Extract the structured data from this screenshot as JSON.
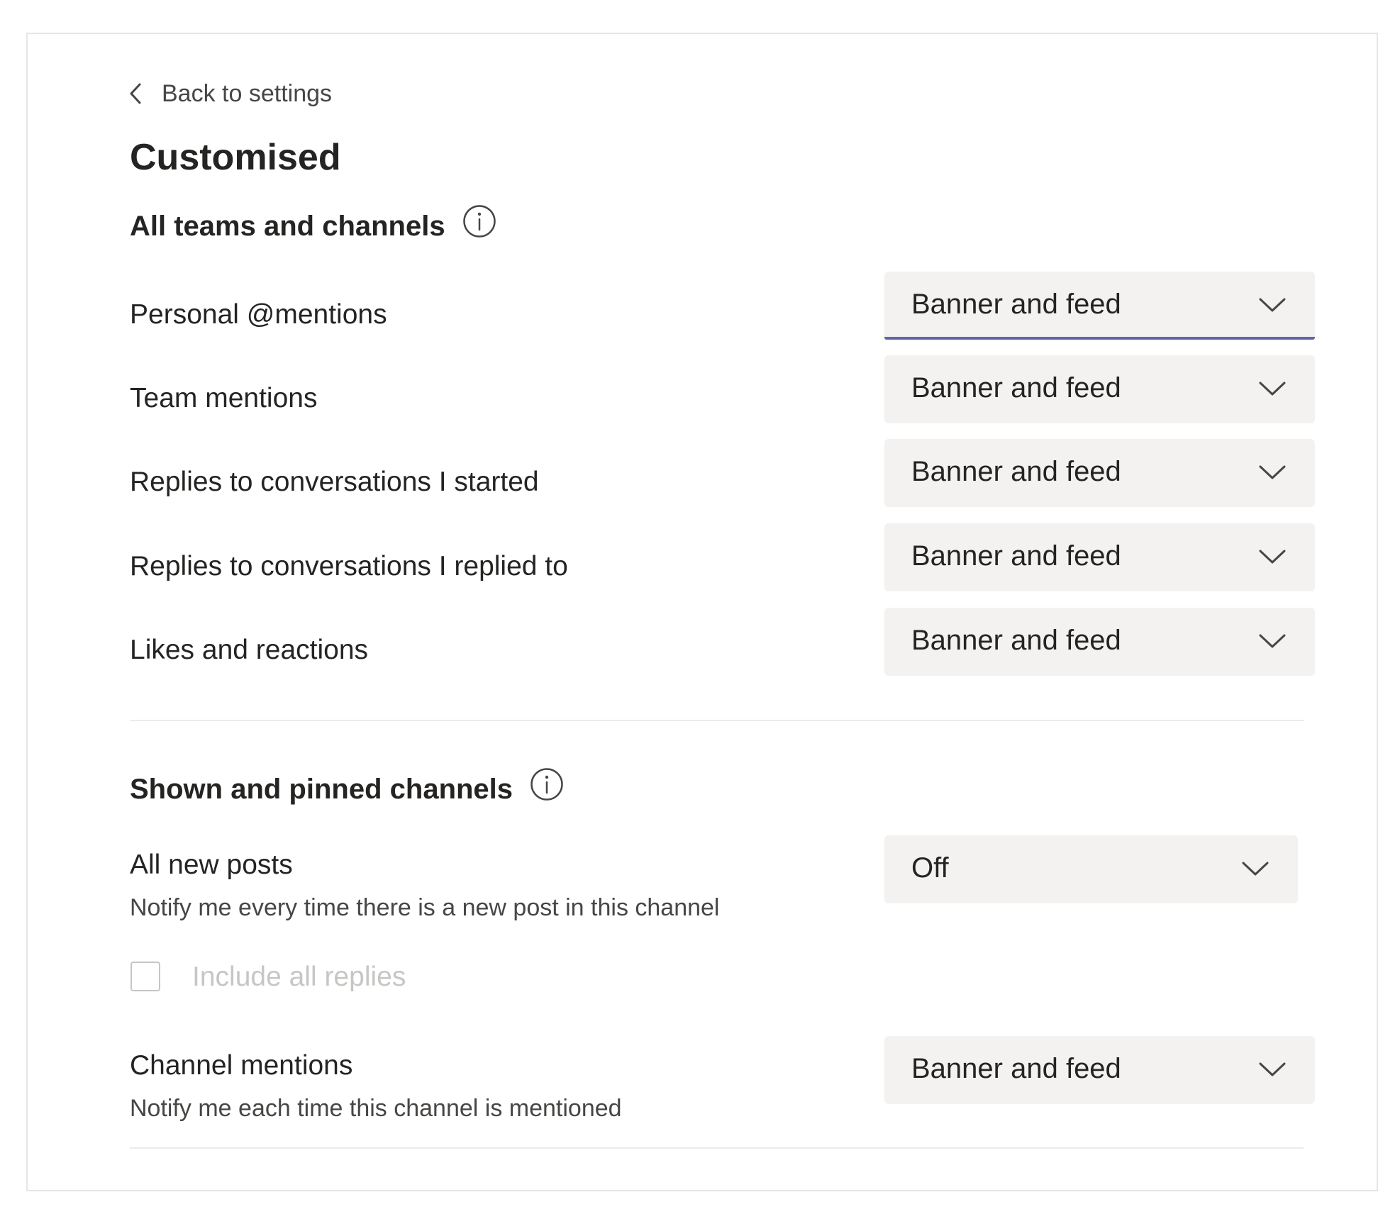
{
  "header": {
    "back_label": "Back to settings",
    "title": "Customised"
  },
  "sections": {
    "all_teams": {
      "title": "All teams and channels",
      "rows": [
        {
          "label": "Personal @mentions",
          "value": "Banner and feed"
        },
        {
          "label": "Team mentions",
          "value": "Banner and feed"
        },
        {
          "label": "Replies to conversations I started",
          "value": "Banner and feed"
        },
        {
          "label": "Replies to conversations I replied to",
          "value": "Banner and feed"
        },
        {
          "label": "Likes and reactions",
          "value": "Banner and feed"
        }
      ]
    },
    "pinned": {
      "title": "Shown and pinned channels",
      "all_new_posts": {
        "label": "All new posts",
        "description": "Notify me every time there is a new post in this channel",
        "value": "Off"
      },
      "include_replies": {
        "label": "Include all replies",
        "checked": false,
        "disabled": true
      },
      "channel_mentions": {
        "label": "Channel mentions",
        "description": "Notify me each time this channel is mentioned",
        "value": "Banner and feed"
      }
    }
  },
  "colors": {
    "accent": "#6264a7",
    "dropdown_bg": "#f3f2f1",
    "text": "#252423",
    "disabled_text": "#c8c6c4"
  },
  "icons": {
    "back": "chevron-left-icon",
    "info": "info-circle-icon",
    "dropdown": "chevron-down-icon"
  }
}
